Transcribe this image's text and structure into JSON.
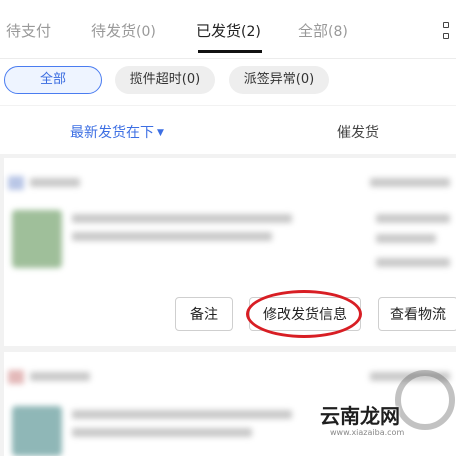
{
  "tabs": [
    {
      "label": "待支付",
      "count": ""
    },
    {
      "label": "待发货",
      "count": "(0)"
    },
    {
      "label": "已发货",
      "count": "(2)"
    },
    {
      "label": "全部",
      "count": "(8)"
    }
  ],
  "filters": [
    "全部",
    "揽件超时(0)",
    "派签异常(0)"
  ],
  "sort": {
    "left": "最新发货在下",
    "right": "催发货"
  },
  "actions": {
    "note": "备注",
    "modify": "修改发货信息",
    "logistics": "查看物流"
  },
  "watermark": {
    "brand": "云南龙网",
    "url": "www.xiazaiba.com"
  },
  "colors": {
    "accent": "#3d6fe3",
    "annotation": "#d81e24"
  }
}
